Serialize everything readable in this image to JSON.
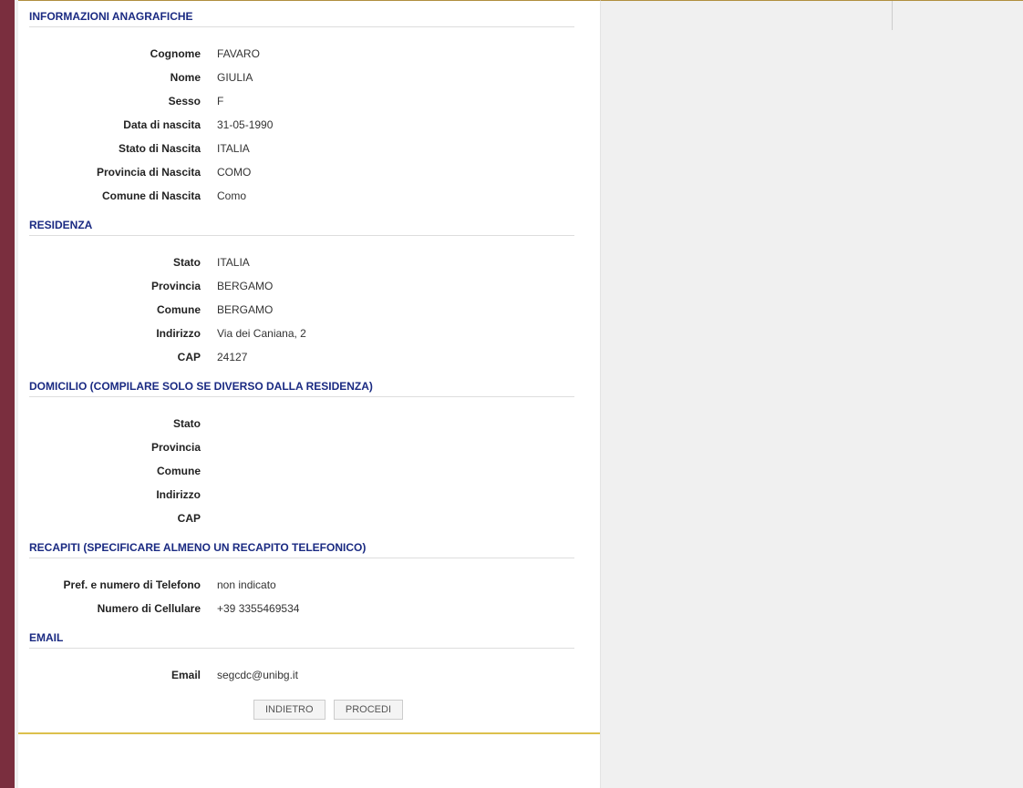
{
  "sections": {
    "anagrafiche": {
      "title": "INFORMAZIONI ANAGRAFICHE",
      "labels": {
        "cognome": "Cognome",
        "nome": "Nome",
        "sesso": "Sesso",
        "data_nascita": "Data di nascita",
        "stato_nascita": "Stato di Nascita",
        "provincia_nascita": "Provincia di Nascita",
        "comune_nascita": "Comune di Nascita"
      },
      "values": {
        "cognome": "FAVARO",
        "nome": "GIULIA",
        "sesso": "F",
        "data_nascita": "31-05-1990",
        "stato_nascita": "ITALIA",
        "provincia_nascita": "COMO",
        "comune_nascita": "Como"
      }
    },
    "residenza": {
      "title": "RESIDENZA",
      "labels": {
        "stato": "Stato",
        "provincia": "Provincia",
        "comune": "Comune",
        "indirizzo": "Indirizzo",
        "cap": "CAP"
      },
      "values": {
        "stato": "ITALIA",
        "provincia": "BERGAMO",
        "comune": "BERGAMO",
        "indirizzo": "Via dei Caniana, 2",
        "cap": "24127"
      }
    },
    "domicilio": {
      "title": "DOMICILIO (COMPILARE SOLO SE DIVERSO DALLA RESIDENZA)",
      "labels": {
        "stato": "Stato",
        "provincia": "Provincia",
        "comune": "Comune",
        "indirizzo": "Indirizzo",
        "cap": "CAP"
      },
      "values": {
        "stato": "",
        "provincia": "",
        "comune": "",
        "indirizzo": "",
        "cap": ""
      }
    },
    "recapiti": {
      "title": "RECAPITI (SPECIFICARE ALMENO UN RECAPITO TELEFONICO)",
      "labels": {
        "telefono": "Pref. e numero di Telefono",
        "cellulare": "Numero di Cellulare"
      },
      "values": {
        "telefono": "non indicato",
        "cellulare": "+39 3355469534"
      }
    },
    "email": {
      "title": "EMAIL",
      "labels": {
        "email": "Email"
      },
      "values": {
        "email": "segcdc@unibg.it"
      }
    }
  },
  "buttons": {
    "indietro": "INDIETRO",
    "procedi": "PROCEDI"
  }
}
